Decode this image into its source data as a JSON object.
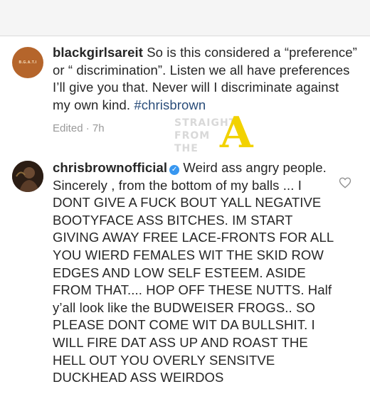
{
  "watermark": {
    "line1": "STRAIGHT",
    "line2": "FROM",
    "line3": "THE",
    "letter": "A"
  },
  "comment1": {
    "avatar_text": "B.G.A.T.I",
    "username": "blackgirlsareit",
    "text": "So is this considered a “preference” or “ discrimination”. Listen we all have preferences I’ll give you that. Never will I discriminate against my own kind.",
    "hashtag": "#chrisbrown",
    "meta": "Edited · 7h"
  },
  "comment2": {
    "username": "chrisbrownofficial",
    "verified_icon": "verified-badge-icon",
    "text": "Weird ass angry people. Sincerely , from the bottom of my balls ... I DONT GIVE A FUCK BOUT YALL NEGATIVE BOOTYFACE ASS BITCHES. IM START GIVING AWAY FREE LACE-FRONTS FOR ALL YOU WIERD FEMALES WIT THE SKID ROW EDGES AND LOW SELF ESTEEM. ASIDE FROM THAT.... HOP OFF THESE NUTTS. Half y’all look like the BUDWEISER FROGS.. SO PLEASE DONT COME WIT DA BULLSHIT. I WILL FIRE DAT ASS UP AND ROAST THE HELL OUT YOU OVERLY SENSITVE DUCKHEAD ASS WEIRDOS",
    "like_icon": "heart-icon"
  }
}
